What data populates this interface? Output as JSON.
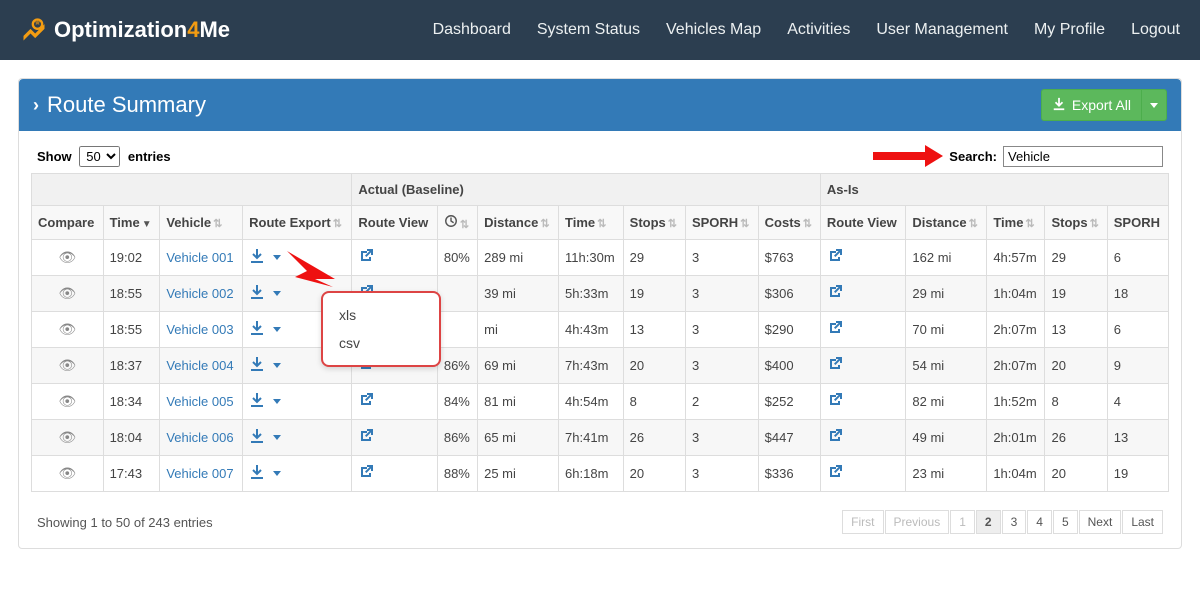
{
  "nav": {
    "brand_prefix": "Optimization",
    "brand_four": "4",
    "brand_suffix": "Me",
    "links": [
      "Dashboard",
      "System Status",
      "Vehicles Map",
      "Activities",
      "User Management",
      "My Profile",
      "Logout"
    ]
  },
  "panel": {
    "title": "Route Summary",
    "export_all": "Export All"
  },
  "toolbar": {
    "show_label_pre": "Show",
    "show_value": "50",
    "show_label_post": "entries",
    "search_label": "Search:",
    "search_value": "Vehicle"
  },
  "headers": {
    "group_actual": "Actual (Baseline)",
    "group_asis": "As-Is",
    "compare": "Compare",
    "time": "Time",
    "vehicle": "Vehicle",
    "route_export": "Route Export",
    "route_view": "Route View",
    "distance": "Distance",
    "time2": "Time",
    "stops": "Stops",
    "sporh": "SPORH",
    "costs": "Costs"
  },
  "export_menu": {
    "opt1": "xls",
    "opt2": "csv"
  },
  "rows": [
    {
      "time": "19:02",
      "vehicle": "Vehicle 001",
      "pct": "80%",
      "a_dist": "289 mi",
      "a_time": "11h:30m",
      "a_stops": "29",
      "a_sporh": "3",
      "a_costs": "$763",
      "i_dist": "162 mi",
      "i_time": "4h:57m",
      "i_stops": "29",
      "i_sporh": "6"
    },
    {
      "time": "18:55",
      "vehicle": "Vehicle 002",
      "pct": "",
      "a_dist": "39 mi",
      "a_time": "5h:33m",
      "a_stops": "19",
      "a_sporh": "3",
      "a_costs": "$306",
      "i_dist": "29 mi",
      "i_time": "1h:04m",
      "i_stops": "19",
      "i_sporh": "18"
    },
    {
      "time": "18:55",
      "vehicle": "Vehicle 003",
      "pct": "",
      "a_dist": "mi",
      "a_time": "4h:43m",
      "a_stops": "13",
      "a_sporh": "3",
      "a_costs": "$290",
      "i_dist": "70 mi",
      "i_time": "2h:07m",
      "i_stops": "13",
      "i_sporh": "6"
    },
    {
      "time": "18:37",
      "vehicle": "Vehicle 004",
      "pct": "86%",
      "a_dist": "69 mi",
      "a_time": "7h:43m",
      "a_stops": "20",
      "a_sporh": "3",
      "a_costs": "$400",
      "i_dist": "54 mi",
      "i_time": "2h:07m",
      "i_stops": "20",
      "i_sporh": "9"
    },
    {
      "time": "18:34",
      "vehicle": "Vehicle 005",
      "pct": "84%",
      "a_dist": "81 mi",
      "a_time": "4h:54m",
      "a_stops": "8",
      "a_sporh": "2",
      "a_costs": "$252",
      "i_dist": "82 mi",
      "i_time": "1h:52m",
      "i_stops": "8",
      "i_sporh": "4"
    },
    {
      "time": "18:04",
      "vehicle": "Vehicle 006",
      "pct": "86%",
      "a_dist": "65 mi",
      "a_time": "7h:41m",
      "a_stops": "26",
      "a_sporh": "3",
      "a_costs": "$447",
      "i_dist": "49 mi",
      "i_time": "2h:01m",
      "i_stops": "26",
      "i_sporh": "13"
    },
    {
      "time": "17:43",
      "vehicle": "Vehicle 007",
      "pct": "88%",
      "a_dist": "25 mi",
      "a_time": "6h:18m",
      "a_stops": "20",
      "a_sporh": "3",
      "a_costs": "$336",
      "i_dist": "23 mi",
      "i_time": "1h:04m",
      "i_stops": "20",
      "i_sporh": "19"
    }
  ],
  "footer": {
    "info": "Showing 1 to 50 of 243 entries",
    "first": "First",
    "prev": "Previous",
    "p1": "1",
    "p2": "2",
    "p3": "3",
    "p4": "4",
    "p5": "5",
    "next": "Next",
    "last": "Last"
  }
}
